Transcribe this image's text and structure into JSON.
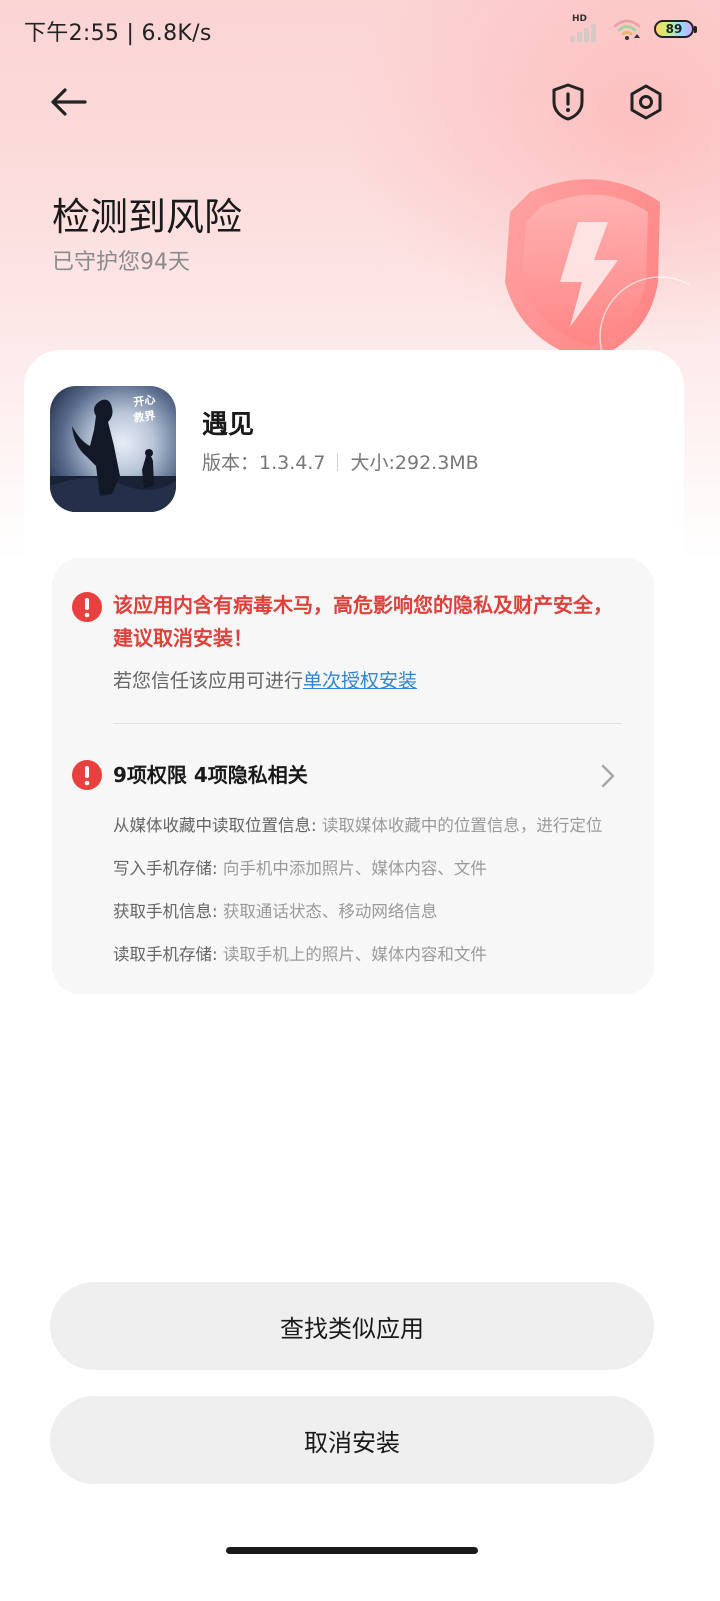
{
  "status_bar": {
    "time": "下午2:55 | 6.8K/s",
    "network_badge": "HD",
    "battery_level": "89",
    "icons": [
      "hd-signal-icon",
      "wifi-icon",
      "battery-icon"
    ]
  },
  "top_bar": {
    "back_icon": "arrow-left-icon",
    "shield_icon": "shield-alert-icon",
    "settings_icon": "gear-icon"
  },
  "header": {
    "title": "检测到风险",
    "subtitle": "已守护您94天",
    "emblem_icon": "lightning-shield-icon"
  },
  "app": {
    "name": "遇见",
    "version": "版本：1.3.4.7",
    "size": "大小:292.3MB",
    "icon_text": "开心 救界"
  },
  "warning": {
    "message": "该应用内含有病毒木马，高危影响您的隐私及财产安全，建议取消安装！",
    "trust_prefix": "若您信任该应用可进行",
    "trust_link": "单次授权安装"
  },
  "permissions": {
    "title": "9项权限 4项隐私相关",
    "items": [
      {
        "label": "从媒体收藏中读取位置信息:",
        "desc": "读取媒体收藏中的位置信息，进行定位"
      },
      {
        "label": "写入手机存储:",
        "desc": "向手机中添加照片、媒体内容、文件"
      },
      {
        "label": "获取手机信息:",
        "desc": "获取通话状态、移动网络信息"
      },
      {
        "label": "读取手机存储:",
        "desc": "读取手机上的照片、媒体内容和文件"
      }
    ]
  },
  "actions": {
    "find_similar": "查找类似应用",
    "cancel_install": "取消安装"
  },
  "colors": {
    "danger": "#e8403e",
    "link": "#2d86d6",
    "button_bg": "#efefef"
  }
}
